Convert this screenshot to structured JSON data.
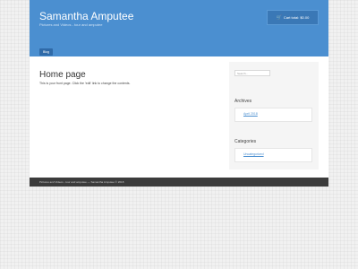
{
  "header": {
    "site_title": "Samantha Amputee",
    "site_description": "Pictures and Videos - tour and amputee",
    "cart_label": "Cart total: $0.00",
    "cart_icon": "shopping-cart-icon",
    "nav": [
      {
        "label": "Blog"
      }
    ]
  },
  "main": {
    "title": "Home page",
    "text": "This is your front page. Click the 'edit' link to change the contents."
  },
  "sidebar": {
    "search_placeholder": "Search...",
    "archives_title": "Archives",
    "archives": [
      {
        "label": "April 2018"
      }
    ],
    "categories_title": "Categories",
    "categories": [
      {
        "label": "Uncategorized"
      }
    ]
  },
  "footer": {
    "text": "Pictures and Videos - tour and amputee — Samantha Amputee © 2018"
  },
  "colors": {
    "accent": "#4b8fd0",
    "footer": "#3c3c3c"
  }
}
